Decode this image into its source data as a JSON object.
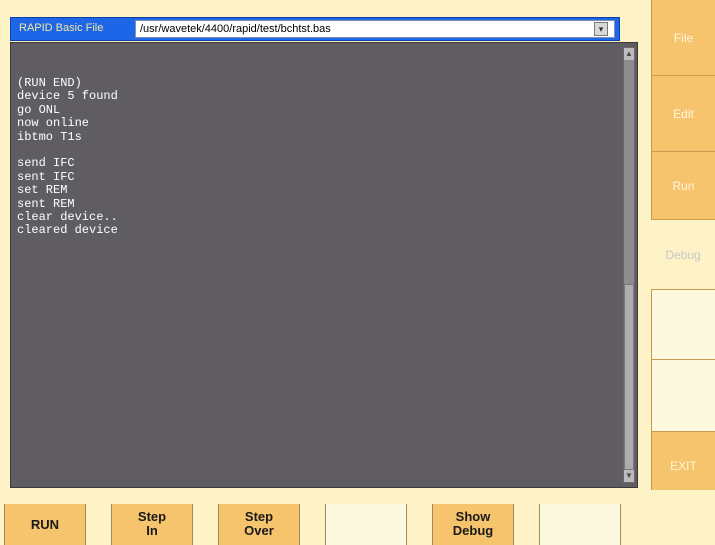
{
  "header": {
    "title": "RAPID Basic File",
    "path": "/usr/wavetek/4400/rapid/test/bchtst.bas"
  },
  "console": {
    "lines": [
      "(RUN END)",
      "device 5 found",
      "go ONL",
      "now online",
      "ibtmo T1s",
      "",
      "send IFC",
      "sent IFC",
      "set REM",
      "sent REM",
      "clear device..",
      "cleared device"
    ]
  },
  "side_menu": {
    "file": "File",
    "edit": "Edit",
    "run": "Run",
    "debug": "Debug",
    "exit": "EXIT"
  },
  "bottom_keys": {
    "run": "RUN",
    "step_in_1": "Step",
    "step_in_2": "In",
    "step_over_1": "Step",
    "step_over_2": "Over",
    "show_debug_1": "Show",
    "show_debug_2": "Debug"
  },
  "colors": {
    "header_bg": "#1e66e8",
    "console_bg": "#5f5d61",
    "softkey_orange": "#f7c46e",
    "panel_bg": "#fdf3c6"
  },
  "icons": {
    "dropdown": "chevron-down-icon",
    "scroll_up": "arrow-up-icon",
    "scroll_down": "arrow-down-icon"
  }
}
